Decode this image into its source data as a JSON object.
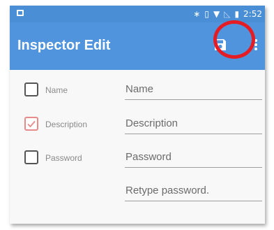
{
  "statusbar": {
    "time": "2:52",
    "icons": [
      "bluetooth-icon",
      "vibrate-icon",
      "wifi-icon",
      "no-signal-icon",
      "battery-icon"
    ]
  },
  "toolbar": {
    "title": "Inspector Edit",
    "save_icon": "save-icon",
    "menu_icon": "more-vertical-icon",
    "highlight_color": "#e51c23"
  },
  "colors": {
    "toolbar_bg": "#4f94dc",
    "statusbar_bg": "#4a8fd6",
    "checked_box": "#e88a8a"
  },
  "form": {
    "rows": [
      {
        "label": "Name",
        "checked": false,
        "field_placeholder": "Name"
      },
      {
        "label": "Description",
        "checked": true,
        "field_placeholder": "Description"
      },
      {
        "label": "Password",
        "checked": false,
        "field_placeholder": "Password"
      }
    ],
    "retype_placeholder": "Retype password."
  }
}
